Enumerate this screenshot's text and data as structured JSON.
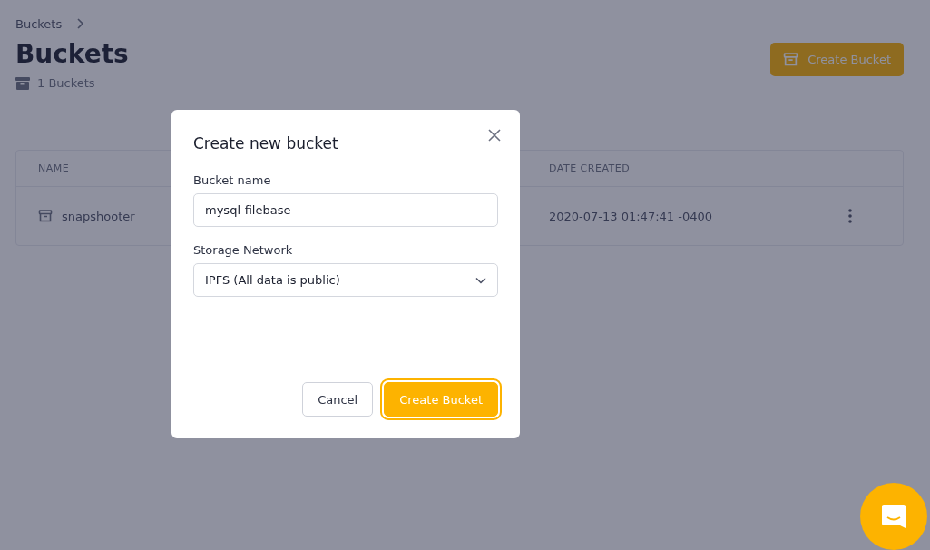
{
  "breadcrumb": {
    "items": [
      "Buckets"
    ]
  },
  "page": {
    "title": "Buckets",
    "count": "1 Buckets",
    "create_button": "Create Bucket"
  },
  "table": {
    "columns": [
      "NAME",
      "DATE CREATED"
    ],
    "rows": [
      {
        "name": "snapshooter",
        "date_created": "2020-07-13 01:47:41 -0400"
      }
    ]
  },
  "dialog": {
    "title": "Create new bucket",
    "fields": [
      {
        "kind": "text",
        "label": "Bucket name",
        "value": "mysql-filebase"
      },
      {
        "kind": "select",
        "label": "Storage Network",
        "value": "IPFS (All data is public)"
      }
    ],
    "buttons": [
      {
        "label": "Cancel",
        "kind": "secondary"
      },
      {
        "label": "Create Bucket",
        "kind": "primary"
      }
    ]
  }
}
